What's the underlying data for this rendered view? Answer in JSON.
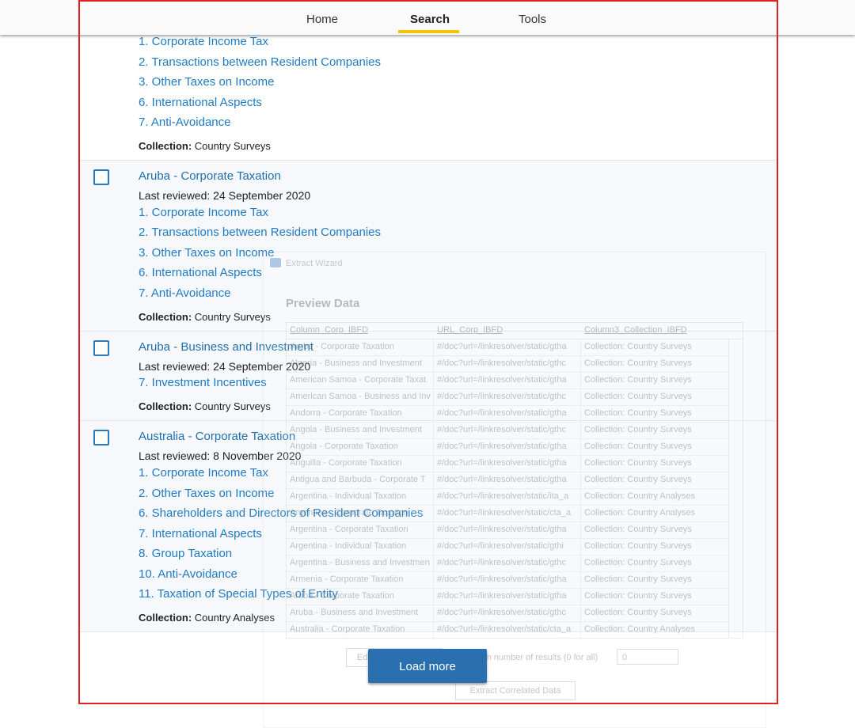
{
  "nav": {
    "home": "Home",
    "search": "Search",
    "tools": "Tools",
    "active": "Search",
    "accent": "#f2c500"
  },
  "results": [
    {
      "title": "",
      "reviewed": "",
      "links": [
        "1. Corporate Income Tax",
        "2. Transactions between Resident Companies",
        "3. Other Taxes on Income",
        "6. International Aspects",
        "7. Anti-Avoidance"
      ],
      "collection_label": "Collection:",
      "collection": "Country Surveys"
    },
    {
      "title": "Aruba - Corporate Taxation",
      "reviewed": "Last reviewed: 24 September 2020",
      "links": [
        "1. Corporate Income Tax",
        "2. Transactions between Resident Companies",
        "3. Other Taxes on Income",
        "6. International Aspects",
        "7. Anti-Avoidance"
      ],
      "collection_label": "Collection:",
      "collection": "Country Surveys"
    },
    {
      "title": "Aruba - Business and Investment",
      "reviewed": "Last reviewed: 24 September 2020",
      "links": [
        "7. Investment Incentives"
      ],
      "collection_label": "Collection:",
      "collection": "Country Surveys"
    },
    {
      "title": "Australia - Corporate Taxation",
      "reviewed": "Last reviewed: 8 November 2020",
      "links": [
        "1. Corporate Income Tax",
        "2. Other Taxes on Income",
        "6. Shareholders and Directors of Resident Companies",
        "7. International Aspects",
        "8. Group Taxation",
        "10. Anti-Avoidance",
        "11. Taxation of Special Types of Entity"
      ],
      "collection_label": "Collection:",
      "collection": "Country Analyses"
    }
  ],
  "load_more": "Load more",
  "wizard": {
    "title": "Extract Wizard",
    "heading": "Preview Data",
    "columns": [
      "Column_Corp_IBFD",
      "URL_Corp_IBFD",
      "Column3_Collection_IBFD"
    ],
    "rows": [
      [
        "Aruba - Corporate Taxation",
        "#/doc?url=/linkresolver/static/gtha",
        "Collection: Country Surveys"
      ],
      [
        "Algeria - Business and Investment",
        "#/doc?url=/linkresolver/static/gthc",
        "Collection: Country Surveys"
      ],
      [
        "American Samoa - Corporate Taxat",
        "#/doc?url=/linkresolver/static/gtha",
        "Collection: Country Surveys"
      ],
      [
        "American Samoa - Business and Inv",
        "#/doc?url=/linkresolver/static/gthc",
        "Collection: Country Surveys"
      ],
      [
        "Andorra - Corporate Taxation",
        "#/doc?url=/linkresolver/static/gtha",
        "Collection: Country Surveys"
      ],
      [
        "Angola - Business and Investment",
        "#/doc?url=/linkresolver/static/gthc",
        "Collection: Country Surveys"
      ],
      [
        "Angola - Corporate Taxation",
        "#/doc?url=/linkresolver/static/gtha",
        "Collection: Country Surveys"
      ],
      [
        "Anguilla - Corporate Taxation",
        "#/doc?url=/linkresolver/static/gtha",
        "Collection: Country Surveys"
      ],
      [
        "Antigua and Barbuda - Corporate T",
        "#/doc?url=/linkresolver/static/gtha",
        "Collection: Country Surveys"
      ],
      [
        "Argentina - Individual Taxation",
        "#/doc?url=/linkresolver/static/ita_a",
        "Collection: Country Analyses"
      ],
      [
        "Argentina - Corporate Taxation",
        "#/doc?url=/linkresolver/static/cta_a",
        "Collection: Country Analyses"
      ],
      [
        "Argentina - Corporate Taxation",
        "#/doc?url=/linkresolver/static/gtha",
        "Collection: Country Surveys"
      ],
      [
        "Argentina - Individual Taxation",
        "#/doc?url=/linkresolver/static/gthi",
        "Collection: Country Surveys"
      ],
      [
        "Argentina - Business and Investmen",
        "#/doc?url=/linkresolver/static/gthc",
        "Collection: Country Surveys"
      ],
      [
        "Armenia - Corporate Taxation",
        "#/doc?url=/linkresolver/static/gtha",
        "Collection: Country Surveys"
      ],
      [
        "Aruba - Corporate Taxation",
        "#/doc?url=/linkresolver/static/gtha",
        "Collection: Country Surveys"
      ],
      [
        "Aruba - Business and Investment",
        "#/doc?url=/linkresolver/static/gthc",
        "Collection: Country Surveys"
      ],
      [
        "Australia - Corporate Taxation",
        "#/doc?url=/linkresolver/static/cta_a",
        "Collection: Country Analyses"
      ]
    ],
    "edit_button": "Edit Data Definition",
    "max_label": "Maximum number of results (0 for all)",
    "max_value": "0",
    "extract_button": "Extract Correlated Data"
  }
}
